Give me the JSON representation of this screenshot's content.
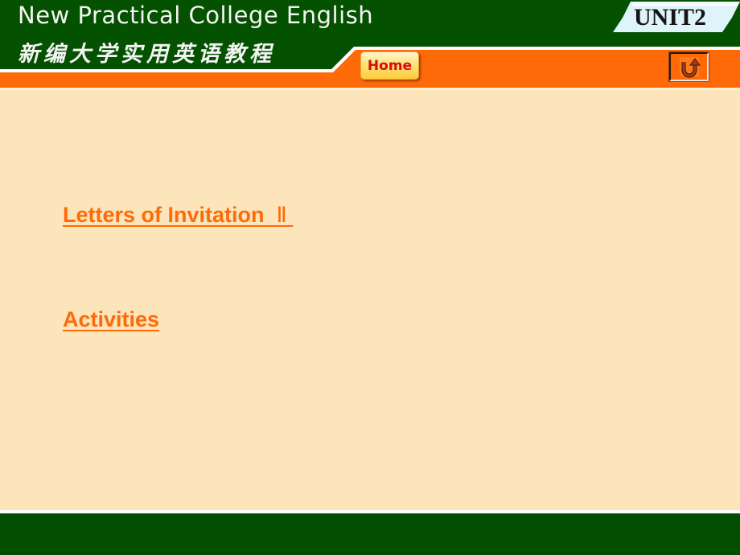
{
  "header": {
    "title_en": "New Practical College English",
    "title_cn": "新编大学实用英语教程",
    "unit_label": "UNIT2",
    "home_label": "Home",
    "back_icon": "u-turn-arrow-icon"
  },
  "colors": {
    "header_green": "#045100",
    "accent_orange": "#ff6a08",
    "background_cream": "#fde5bb",
    "unit_badge": "#dff3fb",
    "home_text": "#d80c0c"
  },
  "content": {
    "links": [
      {
        "label": "Letters of Invitation",
        "suffix": "Ⅱ"
      },
      {
        "label": "Activities"
      }
    ]
  }
}
